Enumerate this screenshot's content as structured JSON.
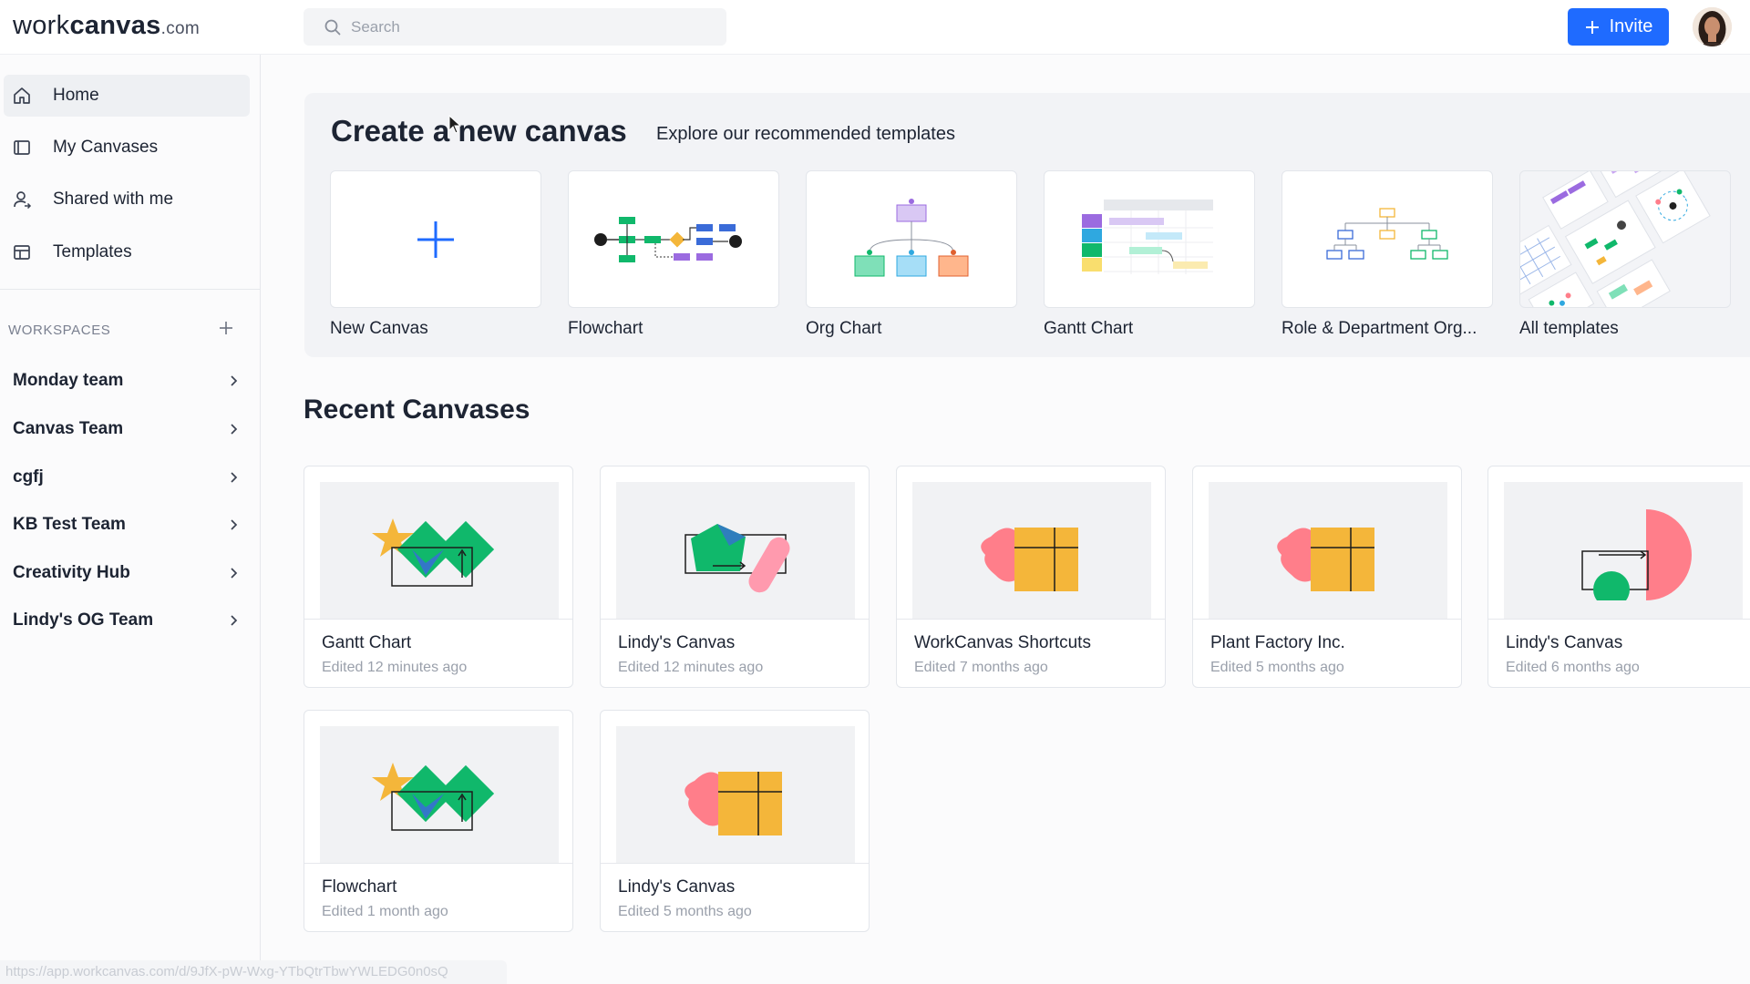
{
  "header": {
    "logo": {
      "part1": "work",
      "part2": "canvas",
      "part3": ".com"
    },
    "search_placeholder": "Search",
    "invite_label": "Invite"
  },
  "sidebar": {
    "nav": [
      {
        "label": "Home",
        "icon": "home-icon",
        "active": true
      },
      {
        "label": "My Canvases",
        "icon": "canvas-icon"
      },
      {
        "label": "Shared with me",
        "icon": "shared-user-icon"
      },
      {
        "label": "Templates",
        "icon": "templates-icon"
      }
    ],
    "workspaces_title": "WORKSPACES",
    "workspaces": [
      {
        "label": "Monday team"
      },
      {
        "label": "Canvas Team"
      },
      {
        "label": "cgfj"
      },
      {
        "label": "KB Test Team"
      },
      {
        "label": "Creativity Hub"
      },
      {
        "label": "Lindy's OG Team"
      }
    ]
  },
  "create": {
    "title": "Create a new canvas",
    "subtitle": "Explore our recommended templates",
    "templates": [
      {
        "label": "New Canvas"
      },
      {
        "label": "Flowchart"
      },
      {
        "label": "Org Chart"
      },
      {
        "label": "Gantt Chart"
      },
      {
        "label": "Role & Department Org..."
      },
      {
        "label": "All templates"
      }
    ]
  },
  "recent": {
    "title": "Recent Canvases",
    "cards": [
      {
        "title": "Gantt Chart",
        "meta": "Edited 12 minutes ago"
      },
      {
        "title": "Lindy's Canvas",
        "meta": "Edited 12 minutes ago"
      },
      {
        "title": "WorkCanvas Shortcuts",
        "meta": "Edited 7 months ago"
      },
      {
        "title": "Plant Factory Inc.",
        "meta": "Edited 5 months ago"
      },
      {
        "title": "Lindy's Canvas",
        "meta": "Edited 6 months ago"
      },
      {
        "title": "Flowchart",
        "meta": "Edited 1 month ago"
      },
      {
        "title": "Lindy's Canvas",
        "meta": "Edited 5 months ago"
      }
    ]
  },
  "statusbar_url": "https://app.workcanvas.com/d/9JfX-pW-Wxg-YTbQtrTbwYWLEDG0n0sQ",
  "colors": {
    "accent": "#1f6bff",
    "green": "#10b86b",
    "yellow": "#f4b63a",
    "pink": "#ff7e8a"
  }
}
